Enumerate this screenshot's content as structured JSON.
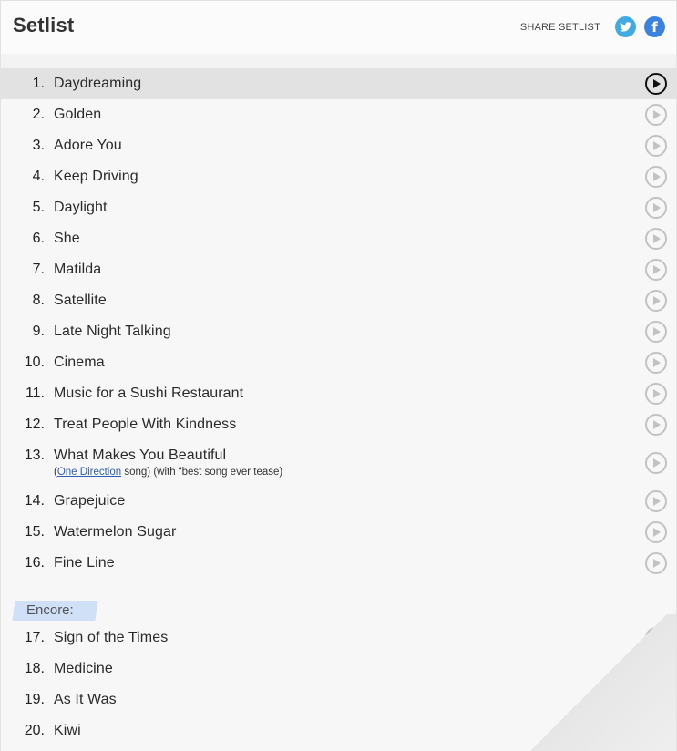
{
  "header": {
    "title": "Setlist",
    "share_label": "SHARE SETLIST",
    "twitter_icon": "twitter-icon",
    "facebook_icon": "facebook-icon",
    "twitter_color": "#41abe1",
    "facebook_color": "#3b82e0"
  },
  "songs": [
    {
      "num": "1.",
      "name": "Daydreaming"
    },
    {
      "num": "2.",
      "name": "Golden"
    },
    {
      "num": "3.",
      "name": "Adore You"
    },
    {
      "num": "4.",
      "name": "Keep Driving"
    },
    {
      "num": "5.",
      "name": "Daylight"
    },
    {
      "num": "6.",
      "name": "She"
    },
    {
      "num": "7.",
      "name": "Matilda"
    },
    {
      "num": "8.",
      "name": "Satellite"
    },
    {
      "num": "9.",
      "name": "Late Night Talking"
    },
    {
      "num": "10.",
      "name": "Cinema"
    },
    {
      "num": "11.",
      "name": "Music for a Sushi Restaurant"
    },
    {
      "num": "12.",
      "name": "Treat People With Kindness"
    },
    {
      "num": "13.",
      "name": "What Makes You Beautiful",
      "info_prefix": "(",
      "info_link": "One Direction",
      "info_suffix": " song) (with “best song ever tease)"
    },
    {
      "num": "14.",
      "name": "Grapejuice"
    },
    {
      "num": "15.",
      "name": "Watermelon Sugar"
    },
    {
      "num": "16.",
      "name": "Fine Line"
    }
  ],
  "encore": {
    "label": "Encore:",
    "songs": [
      {
        "num": "17.",
        "name": "Sign of the Times"
      },
      {
        "num": "18.",
        "name": "Medicine"
      },
      {
        "num": "19.",
        "name": "As It Was"
      },
      {
        "num": "20.",
        "name": "Kiwi"
      }
    ]
  },
  "playing_index": 0,
  "play_icon": "play-icon"
}
